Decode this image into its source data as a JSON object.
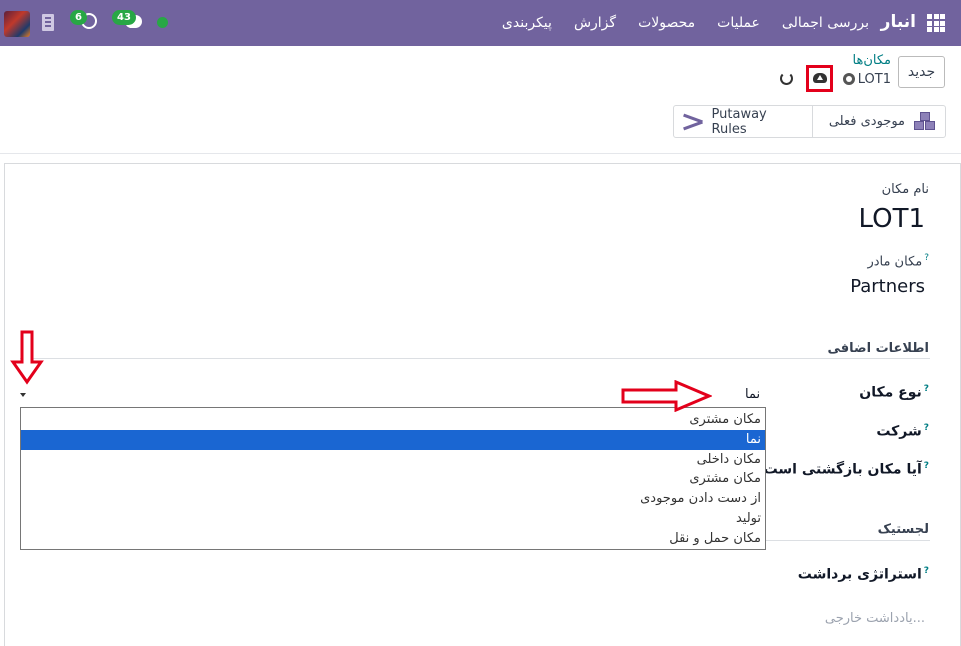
{
  "navbar": {
    "brand": "انبار",
    "menu": [
      "بررسی اجمالی",
      "عملیات",
      "محصولات",
      "گزارش",
      "پیکربندی"
    ],
    "activity_count": "6",
    "messages_count": "43"
  },
  "control": {
    "new_label": "جدید",
    "breadcrumb_parent": "مکان‌ها",
    "breadcrumb_current": "LOT1"
  },
  "stat_buttons": {
    "putaway": "Putaway Rules",
    "stock": "موجودی فعلی"
  },
  "form": {
    "name_label": "نام مکان",
    "name_value": "LOT1",
    "parent_label": "مکان مادر",
    "parent_value": "Partners",
    "help_mark": "?",
    "section_extra": "اطلاعات اضافی",
    "type_label": "نوع مکان",
    "type_value": "نما",
    "company_label": "شرکت",
    "return_label": "آیا مکان بازگشتی است؟",
    "section_logistics": "لجستیک",
    "removal_label": "استراتژی برداشت",
    "notes_placeholder": "یادداشت خارجی..."
  },
  "dropdown": {
    "options": [
      "مکان مشتری",
      "نما",
      "مکان داخلی",
      "مکان مشتری",
      "از دست دادن موجودی",
      "تولید",
      "مکان حمل و نقل"
    ],
    "selected_index": 1
  },
  "colors": {
    "navbar": "#71639e",
    "selected_option": "#1a66d2",
    "annotation": "#e3001b",
    "badge": "#28a745"
  }
}
